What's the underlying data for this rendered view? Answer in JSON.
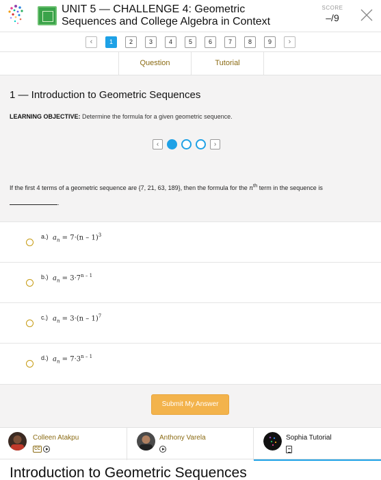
{
  "header": {
    "unit_title": "UNIT 5 — CHALLENGE 4: Geometric Sequences and College Algebra in Context",
    "score_label": "SCORE",
    "score_value": "–/9"
  },
  "pager": {
    "prev": "‹",
    "next": "›",
    "pages": [
      "1",
      "2",
      "3",
      "4",
      "5",
      "6",
      "7",
      "8",
      "9"
    ],
    "active_page": "1"
  },
  "tabs": {
    "question": "Question",
    "tutorial": "Tutorial"
  },
  "question": {
    "lesson_title": "1 — Introduction to Geometric Sequences",
    "objective_label": "LEARNING OBJECTIVE:",
    "objective_text": "Determine the formula for a given geometric sequence.",
    "stepper_prev": "‹",
    "stepper_next": "›",
    "text_before": "If the first 4 terms of a geometric sequence are {7, 21, 63, 189}, then the formula for the ",
    "text_n": "n",
    "text_th": "th",
    "text_after": " term in the sequence is ",
    "text_end": "."
  },
  "choices": [
    {
      "label": "a.)",
      "base": "7·(n – 1)",
      "exp": "3"
    },
    {
      "label": "b.)",
      "base": "3·7",
      "exp": "n – 1"
    },
    {
      "label": "c.)",
      "base": "3·(n – 1)",
      "exp": "7"
    },
    {
      "label": "d.)",
      "base": "7·3",
      "exp": "n – 1"
    }
  ],
  "formula_prefix": "a",
  "formula_sub": "n",
  "formula_eq": " = ",
  "submit_label": "Submit My Answer",
  "tutors": [
    {
      "name": "Colleen Atakpu",
      "cc": "CC"
    },
    {
      "name": "Anthony Varela"
    },
    {
      "name": "Sophia Tutorial"
    }
  ],
  "bottom_title": "Introduction to Geometric Sequences",
  "colors": {
    "accent_blue": "#1ea1e6",
    "gold": "#8a6a12",
    "submit": "#f3b34c"
  }
}
